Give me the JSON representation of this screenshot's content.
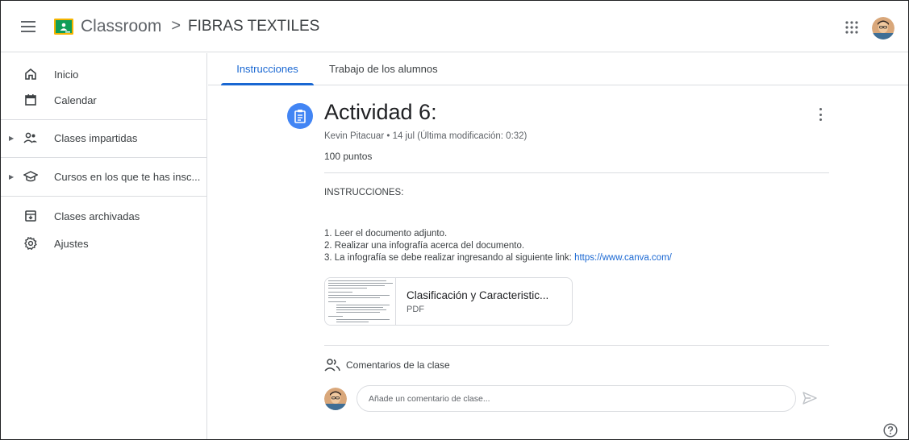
{
  "header": {
    "brand": "Classroom",
    "separator": ">",
    "class_name": "FIBRAS TEXTILES"
  },
  "sidebar": {
    "items": [
      {
        "label": "Inicio",
        "icon": "home-icon"
      },
      {
        "label": "Calendar",
        "icon": "calendar-icon"
      },
      {
        "label": "Clases impartidas",
        "icon": "people-icon"
      },
      {
        "label": "Cursos en los que te has insc...",
        "icon": "school-icon"
      },
      {
        "label": "Clases archivadas",
        "icon": "archive-icon"
      },
      {
        "label": "Ajustes",
        "icon": "gear-icon"
      }
    ]
  },
  "tabs": [
    {
      "label": "Instrucciones",
      "active": true
    },
    {
      "label": "Trabajo de los alumnos",
      "active": false
    }
  ],
  "assignment": {
    "title": "Actividad 6:",
    "meta": "Kevin Pitacuar • 14 jul (Última modificación: 0:32)",
    "points": "100 puntos",
    "instructions_heading": "INSTRUCCIONES:",
    "steps": [
      "1. Leer el documento adjunto.",
      "2. Realizar una infografía acerca del documento.",
      "3. La infografía se debe realizar ingresando al siguiente link: "
    ],
    "link_text": "https://www.canva.com/"
  },
  "attachment": {
    "name": "Clasificación y Caracteristic...",
    "type": "PDF"
  },
  "comments": {
    "title": "Comentarios de la clase",
    "placeholder": "Añade un comentario de clase..."
  },
  "colors": {
    "accent": "#1967d2",
    "assignment_icon": "#4285f4",
    "logo_green": "#0f9d58",
    "logo_yellow": "#f4b400"
  }
}
